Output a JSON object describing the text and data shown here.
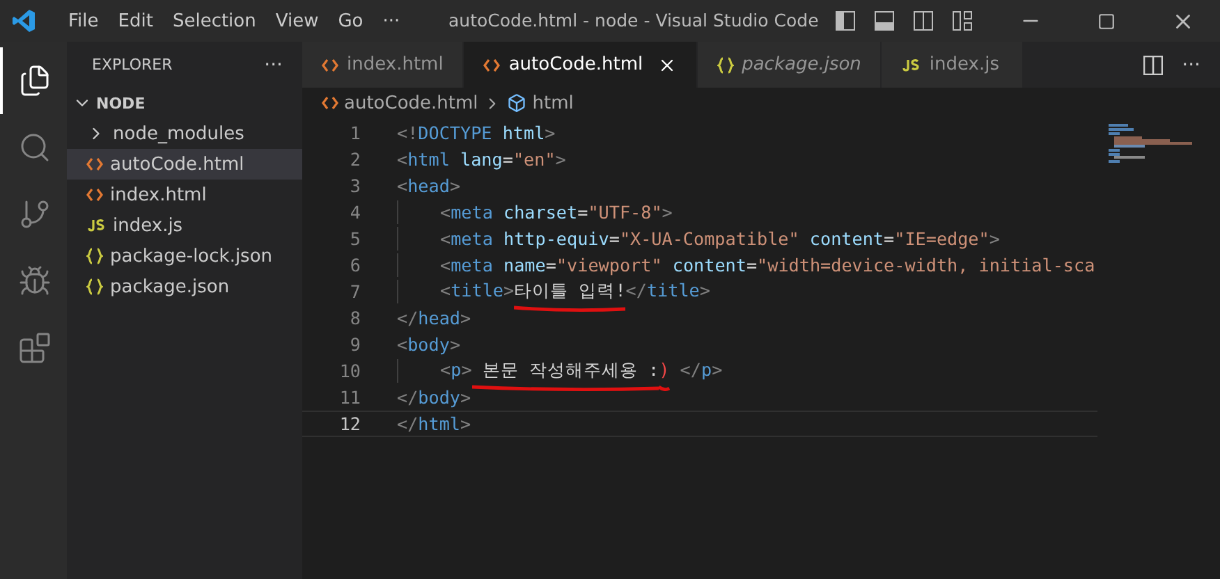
{
  "title_bar": {
    "menus": [
      "File",
      "Edit",
      "Selection",
      "View",
      "Go",
      "···"
    ],
    "title": "autoCode.html - node - Visual Studio Code"
  },
  "activity_bar": [
    {
      "kind": "files",
      "selected": true
    },
    {
      "kind": "search",
      "selected": false
    },
    {
      "kind": "source-control",
      "selected": false
    },
    {
      "kind": "run",
      "selected": false
    },
    {
      "kind": "extensions",
      "selected": false
    }
  ],
  "sidebar": {
    "title": "EXPLORER",
    "more": "···",
    "folder": {
      "name": "NODE",
      "expanded": true,
      "children": [
        {
          "name": "node_modules",
          "kind": "folder",
          "expanded": false,
          "selected": false
        },
        {
          "name": "autoCode.html",
          "kind": "html",
          "selected": true
        },
        {
          "name": "index.html",
          "kind": "html",
          "selected": false
        },
        {
          "name": "index.js",
          "kind": "js",
          "selected": false
        },
        {
          "name": "package-lock.json",
          "kind": "json",
          "selected": false
        },
        {
          "name": "package.json",
          "kind": "json",
          "selected": false
        }
      ]
    }
  },
  "tabs": [
    {
      "label": "index.html",
      "kind": "html",
      "selected": false,
      "preview": false
    },
    {
      "label": "autoCode.html",
      "kind": "html",
      "selected": true,
      "preview": false
    },
    {
      "label": "package.json",
      "kind": "json",
      "selected": false,
      "preview": true
    },
    {
      "label": "index.js",
      "kind": "js",
      "selected": false,
      "preview": false
    }
  ],
  "tab_actions": {
    "more": "···"
  },
  "breadcrumb": [
    {
      "label": "autoCode.html",
      "kind": "html"
    },
    {
      "label": "html",
      "kind": "element"
    }
  ],
  "code_lines": [
    {
      "number": "1",
      "indented": false,
      "current": false,
      "tokens": [
        {
          "kind": "punct",
          "text": "<!"
        },
        {
          "kind": "tag",
          "text": "DOCTYPE"
        },
        {
          "kind": "attr",
          "text": " html"
        },
        {
          "kind": "punct",
          "text": ">"
        }
      ]
    },
    {
      "number": "2",
      "indented": false,
      "current": false,
      "tokens": [
        {
          "kind": "punct",
          "text": "<"
        },
        {
          "kind": "tag",
          "text": "html"
        },
        {
          "kind": "attr",
          "text": " lang"
        },
        {
          "kind": "text",
          "text": "="
        },
        {
          "kind": "str",
          "text": "\"en\""
        },
        {
          "kind": "punct",
          "text": ">"
        }
      ]
    },
    {
      "number": "3",
      "indented": false,
      "current": false,
      "tokens": [
        {
          "kind": "punct",
          "text": "<"
        },
        {
          "kind": "tag",
          "text": "head"
        },
        {
          "kind": "punct",
          "text": ">"
        }
      ]
    },
    {
      "number": "4",
      "indented": true,
      "current": false,
      "tokens": [
        {
          "kind": "punct",
          "text": "<"
        },
        {
          "kind": "tag",
          "text": "meta"
        },
        {
          "kind": "attr",
          "text": " charset"
        },
        {
          "kind": "text",
          "text": "="
        },
        {
          "kind": "str",
          "text": "\"UTF-8\""
        },
        {
          "kind": "punct",
          "text": ">"
        }
      ]
    },
    {
      "number": "5",
      "indented": true,
      "current": false,
      "tokens": [
        {
          "kind": "punct",
          "text": "<"
        },
        {
          "kind": "tag",
          "text": "meta"
        },
        {
          "kind": "attr",
          "text": " http-equiv"
        },
        {
          "kind": "text",
          "text": "="
        },
        {
          "kind": "str",
          "text": "\"X-UA-Compatible\""
        },
        {
          "kind": "attr",
          "text": " content"
        },
        {
          "kind": "text",
          "text": "="
        },
        {
          "kind": "str",
          "text": "\"IE=edge\""
        },
        {
          "kind": "punct",
          "text": ">"
        }
      ]
    },
    {
      "number": "6",
      "indented": true,
      "current": false,
      "tokens": [
        {
          "kind": "punct",
          "text": "<"
        },
        {
          "kind": "tag",
          "text": "meta"
        },
        {
          "kind": "attr",
          "text": " name"
        },
        {
          "kind": "text",
          "text": "="
        },
        {
          "kind": "str",
          "text": "\"viewport\""
        },
        {
          "kind": "attr",
          "text": " content"
        },
        {
          "kind": "text",
          "text": "="
        },
        {
          "kind": "str",
          "text": "\"width=device-width, initial-sca"
        }
      ]
    },
    {
      "number": "7",
      "indented": true,
      "current": false,
      "tokens": [
        {
          "kind": "punct",
          "text": "<"
        },
        {
          "kind": "tag",
          "text": "title"
        },
        {
          "kind": "punct",
          "text": ">"
        },
        {
          "kind": "text",
          "text": "타이틀 입력!",
          "underlined": true
        },
        {
          "kind": "punct",
          "text": "</"
        },
        {
          "kind": "tag",
          "text": "title"
        },
        {
          "kind": "punct",
          "text": ">"
        }
      ]
    },
    {
      "number": "8",
      "indented": false,
      "current": false,
      "tokens": [
        {
          "kind": "punct",
          "text": "</"
        },
        {
          "kind": "tag",
          "text": "head"
        },
        {
          "kind": "punct",
          "text": ">"
        }
      ]
    },
    {
      "number": "9",
      "indented": false,
      "current": false,
      "tokens": [
        {
          "kind": "punct",
          "text": "<"
        },
        {
          "kind": "tag",
          "text": "body"
        },
        {
          "kind": "punct",
          "text": ">"
        }
      ]
    },
    {
      "number": "10",
      "indented": true,
      "current": false,
      "tokens": [
        {
          "kind": "punct",
          "text": "<"
        },
        {
          "kind": "tag",
          "text": "p"
        },
        {
          "kind": "punct",
          "text": ">"
        },
        {
          "kind": "text",
          "text": " 본문 작성해주세용 :",
          "underlined": true
        },
        {
          "kind": "error",
          "text": ")",
          "underlined": true
        },
        {
          "kind": "punct",
          "text": " </"
        },
        {
          "kind": "tag",
          "text": "p"
        },
        {
          "kind": "punct",
          "text": ">"
        }
      ]
    },
    {
      "number": "11",
      "indented": false,
      "current": false,
      "tokens": [
        {
          "kind": "punct",
          "text": "</"
        },
        {
          "kind": "tag",
          "text": "body"
        },
        {
          "kind": "punct",
          "text": ">"
        }
      ]
    },
    {
      "number": "12",
      "indented": false,
      "current": true,
      "tokens": [
        {
          "kind": "punct",
          "text": "</"
        },
        {
          "kind": "tag",
          "text": "html"
        },
        {
          "kind": "punct",
          "text": ">"
        }
      ]
    }
  ]
}
